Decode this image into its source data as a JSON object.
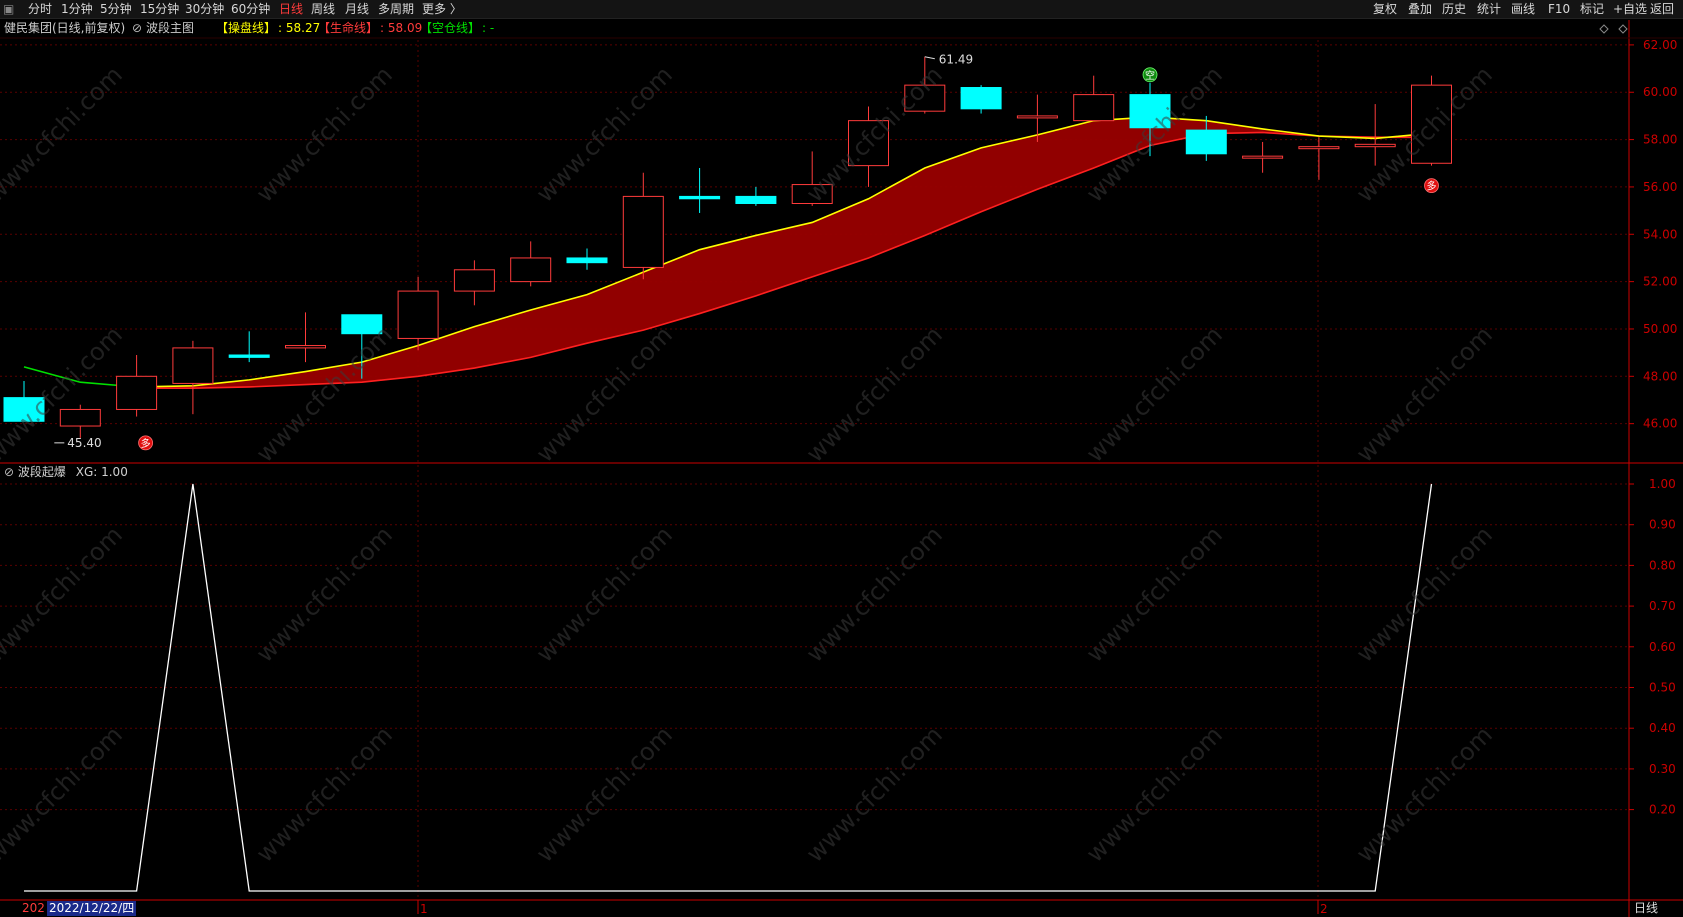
{
  "topbar": {
    "left_items": [
      "分时",
      "1分钟",
      "5分钟",
      "15分钟",
      "30分钟",
      "60分钟",
      "日线",
      "周线",
      "月线",
      "多周期",
      "更多 〉"
    ],
    "active": "日线",
    "right_items": [
      "复权",
      "叠加",
      "历史",
      "统计",
      "画线",
      "F10",
      "标记",
      "+自选",
      "返回"
    ]
  },
  "info": {
    "stock": "健民集团(日线,前复权)",
    "indicator": "波段主图",
    "line1_label": "【操盘线】",
    "line1_value": ": 58.27",
    "line2_label": "【生命线】",
    "line2_value": ": 58.09",
    "line3_label": "【空仓线】",
    "line3_value": ": -"
  },
  "sub": {
    "title": "波段起爆",
    "value": "XG: 1.00"
  },
  "colors": {
    "up": "#ff3b3b",
    "down": "#00ffff",
    "yellow": "#ffff00",
    "green": "#00e000",
    "band": "#990000",
    "grid": "#5a0000",
    "axis": "#cc0000"
  },
  "chart_data": [
    {
      "type": "candlestick",
      "title": "健民集团(日线,前复权)",
      "y_ticks": [
        "62.00",
        "60.00",
        "58.00",
        "56.00",
        "54.00",
        "52.00",
        "50.00",
        "48.00",
        "46.00"
      ],
      "ylim": [
        44.0,
        62.7
      ],
      "candles": [
        {
          "o": 47.1,
          "h": 47.8,
          "l": 46.1,
          "c": 46.1
        },
        {
          "o": 45.9,
          "h": 46.8,
          "l": 45.4,
          "c": 46.6
        },
        {
          "o": 46.6,
          "h": 48.9,
          "l": 46.3,
          "c": 48.0
        },
        {
          "o": 47.7,
          "h": 49.5,
          "l": 46.4,
          "c": 49.2
        },
        {
          "o": 48.9,
          "h": 49.9,
          "l": 48.6,
          "c": 48.8
        },
        {
          "o": 49.2,
          "h": 50.7,
          "l": 48.6,
          "c": 49.3
        },
        {
          "o": 50.6,
          "h": 50.6,
          "l": 47.9,
          "c": 49.8
        },
        {
          "o": 49.6,
          "h": 52.2,
          "l": 49.1,
          "c": 51.6
        },
        {
          "o": 51.6,
          "h": 52.9,
          "l": 51.0,
          "c": 52.5
        },
        {
          "o": 52.0,
          "h": 53.7,
          "l": 51.8,
          "c": 53.0
        },
        {
          "o": 53.0,
          "h": 53.4,
          "l": 52.5,
          "c": 52.8
        },
        {
          "o": 52.6,
          "h": 56.6,
          "l": 52.1,
          "c": 55.6
        },
        {
          "o": 55.6,
          "h": 56.8,
          "l": 54.9,
          "c": 55.5
        },
        {
          "o": 55.6,
          "h": 56.0,
          "l": 55.2,
          "c": 55.3
        },
        {
          "o": 55.3,
          "h": 57.5,
          "l": 55.2,
          "c": 56.1
        },
        {
          "o": 56.9,
          "h": 59.4,
          "l": 56.0,
          "c": 58.8
        },
        {
          "o": 59.2,
          "h": 61.5,
          "l": 59.1,
          "c": 60.3
        },
        {
          "o": 60.2,
          "h": 60.3,
          "l": 59.1,
          "c": 59.3
        },
        {
          "o": 59.0,
          "h": 59.9,
          "l": 57.9,
          "c": 59.0
        },
        {
          "o": 58.8,
          "h": 60.7,
          "l": 58.8,
          "c": 59.9
        },
        {
          "o": 59.9,
          "h": 60.4,
          "l": 57.3,
          "c": 58.5
        },
        {
          "o": 58.4,
          "h": 59.0,
          "l": 57.1,
          "c": 57.4
        },
        {
          "o": 57.3,
          "h": 57.9,
          "l": 56.6,
          "c": 57.3
        },
        {
          "o": 57.7,
          "h": 58.1,
          "l": 56.3,
          "c": 57.7
        },
        {
          "o": 57.7,
          "h": 59.5,
          "l": 56.9,
          "c": 57.8
        },
        {
          "o": 57.0,
          "h": 60.7,
          "l": 56.9,
          "c": 60.3
        }
      ],
      "series": [
        {
          "name": "【操盘线】",
          "values": [
            48.4,
            47.75,
            47.55,
            47.6,
            47.85,
            48.2,
            48.6,
            49.3,
            50.1,
            50.8,
            51.45,
            52.4,
            53.35,
            53.95,
            54.5,
            55.5,
            56.8,
            57.65,
            58.2,
            58.8,
            58.95,
            58.8,
            58.45,
            58.15,
            58.05,
            58.27
          ]
        },
        {
          "name": "【生命线】",
          "values": [
            null,
            null,
            47.5,
            47.5,
            47.55,
            47.65,
            47.75,
            48.0,
            48.35,
            48.8,
            49.4,
            49.95,
            50.65,
            51.4,
            52.2,
            53.0,
            53.95,
            54.95,
            55.9,
            56.8,
            57.75,
            58.25,
            58.3,
            58.15,
            58.1,
            58.09
          ]
        }
      ],
      "annotations": [
        {
          "text": "61.49",
          "candle": 16,
          "type": "high"
        },
        {
          "text": "45.40",
          "candle": 1,
          "type": "low"
        },
        {
          "text": "多",
          "candle": 2,
          "type": "signal"
        },
        {
          "text": "空",
          "candle": 20,
          "type": "signal"
        },
        {
          "text": "多",
          "candle": 25,
          "type": "signal"
        }
      ]
    },
    {
      "type": "line",
      "title": "波段起爆",
      "y_ticks": [
        "1.00",
        "0.90",
        "0.80",
        "0.70",
        "0.60",
        "0.50",
        "0.40",
        "0.30",
        "0.20"
      ],
      "ylim": [
        0,
        1.0
      ],
      "series": [
        {
          "name": "XG",
          "values": [
            0,
            0,
            0,
            1,
            0,
            0,
            0,
            0,
            0,
            0,
            0,
            0,
            0,
            0,
            0,
            0,
            0,
            0,
            0,
            0,
            0,
            0,
            0,
            0,
            0,
            1
          ]
        }
      ]
    }
  ],
  "bottom": {
    "date_prefix": "202",
    "date": "2022/12/22/四",
    "month_labels": [
      "1",
      "2"
    ],
    "period": "日线"
  },
  "watermark": "www.cfchi.com"
}
